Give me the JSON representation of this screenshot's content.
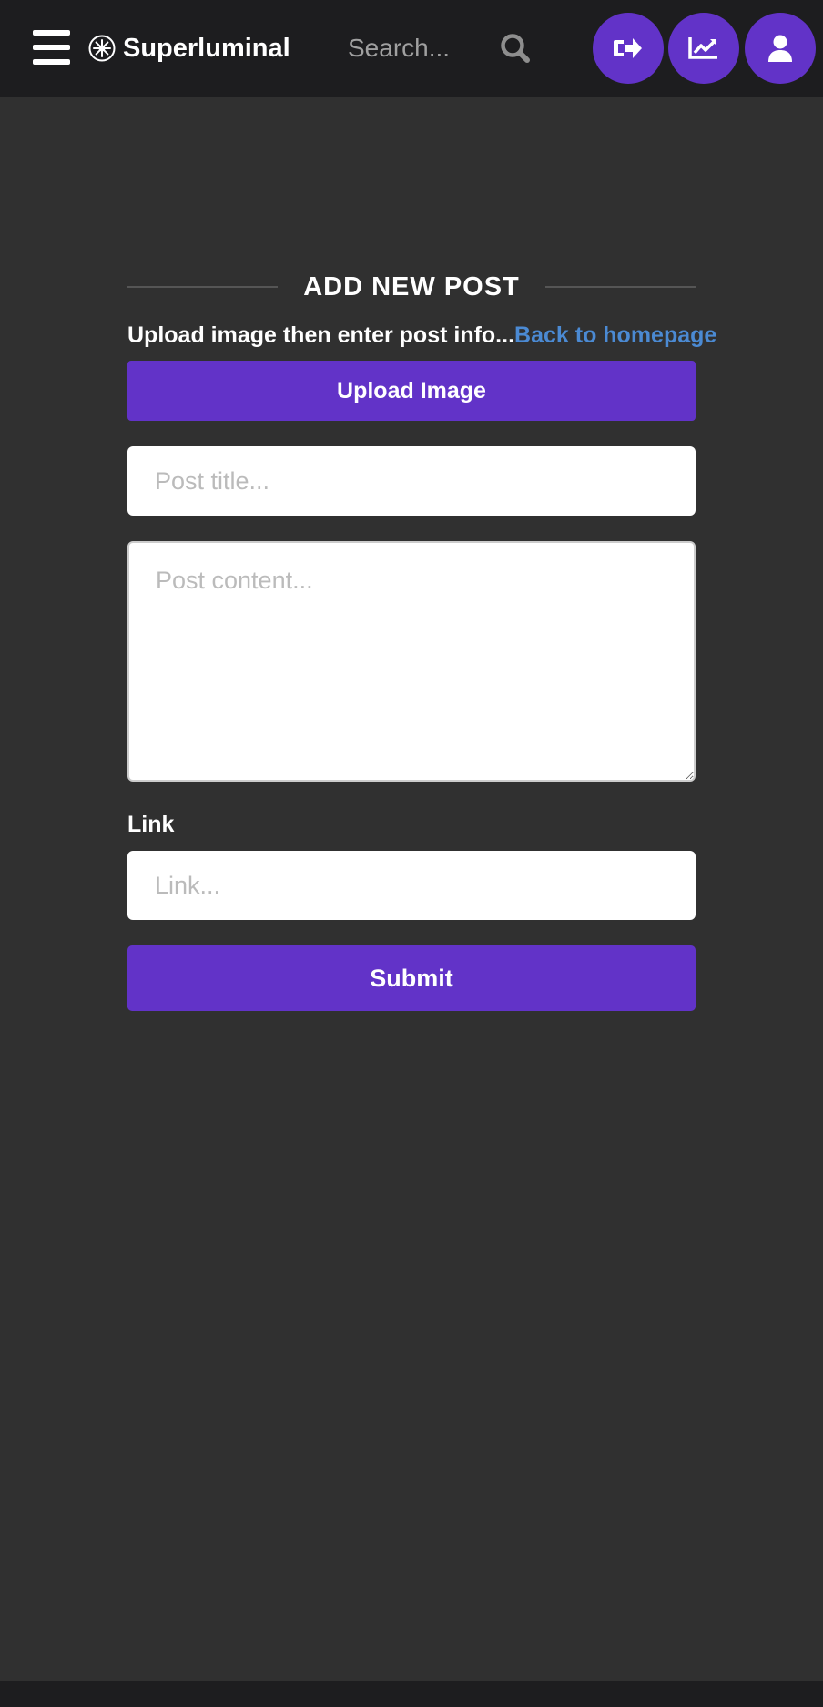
{
  "header": {
    "brand_name": "Superluminal",
    "search_placeholder": "Search...",
    "icons": {
      "menu": "hamburger-menu-icon",
      "logo": "superluminal-logo-icon",
      "search": "search-icon",
      "logout": "logout-icon",
      "stats": "chart-line-icon",
      "profile": "user-icon"
    }
  },
  "form": {
    "heading": "ADD NEW POST",
    "info_text": "Upload image then enter post info...",
    "back_link_label": "Back to homepage",
    "upload_button_label": "Upload Image",
    "title_placeholder": "Post title...",
    "content_placeholder": "Post content...",
    "link_label": "Link",
    "link_placeholder": "Link...",
    "submit_label": "Submit"
  },
  "colors": {
    "background": "#303030",
    "topbar": "#1d1d1f",
    "accent": "#6233c8",
    "link": "#4b8ad3"
  }
}
